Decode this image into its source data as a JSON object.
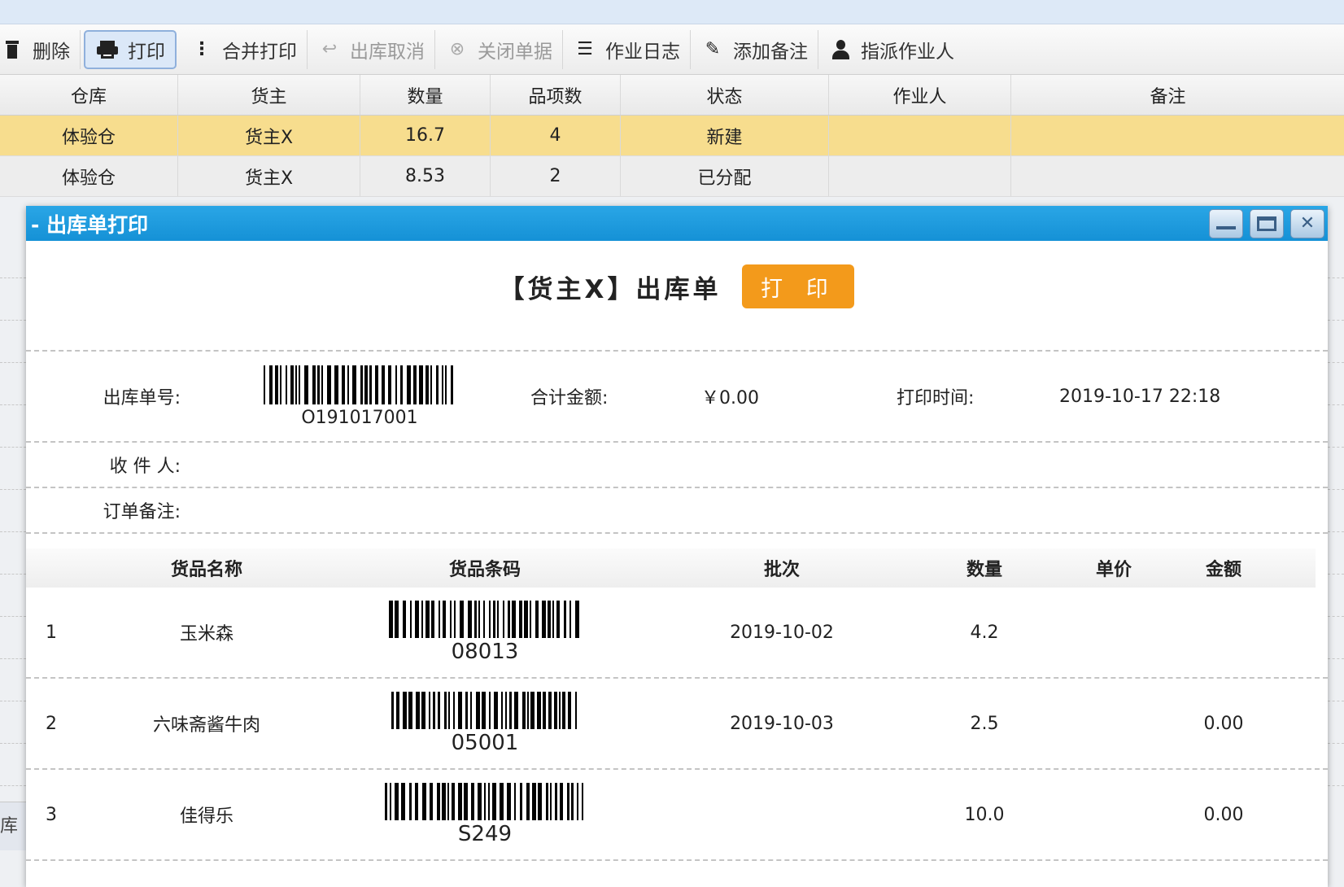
{
  "toolbar": {
    "delete_label": "删除",
    "print_label": "打印",
    "merge_print_label": "合并打印",
    "cancel_outbound_label": "出库取消",
    "close_doc_label": "关闭单据",
    "work_log_label": "作业日志",
    "add_note_label": "添加备注",
    "assign_worker_label": "指派作业人"
  },
  "grid": {
    "columns": [
      "仓库",
      "货主",
      "数量",
      "品项数",
      "状态",
      "作业人",
      "备注"
    ],
    "rows": [
      {
        "warehouse": "体验仓",
        "owner": "货主X",
        "qty": "16.7",
        "items": "4",
        "status": "新建",
        "worker": "",
        "note": ""
      },
      {
        "warehouse": "体验仓",
        "owner": "货主X",
        "qty": "8.53",
        "items": "2",
        "status": "已分配",
        "worker": "",
        "note": ""
      }
    ],
    "partial_bottom_label": "库"
  },
  "dialog": {
    "title": "- 出库单打印",
    "doc_title": "【货主X】出库单",
    "print_button": "打 印",
    "order_no_label": "出库单号:",
    "order_no": "O191017001",
    "total_label": "合计金额:",
    "total_value": "￥0.00",
    "print_time_label": "打印时间:",
    "print_time": "2019-10-17 22:18",
    "recipient_label": "收 件 人:",
    "order_note_label": "订单备注:",
    "items_columns": [
      "",
      "货品名称",
      "货品条码",
      "批次",
      "数量",
      "单价",
      "金额"
    ],
    "items": [
      {
        "index": "1",
        "name": "玉米森",
        "barcode": "08013",
        "batch": "2019-10-02",
        "qty": "4.2",
        "price": "",
        "amount": ""
      },
      {
        "index": "2",
        "name": "六味斋酱牛肉",
        "barcode": "05001",
        "batch": "2019-10-03",
        "qty": "2.5",
        "price": "",
        "amount": "0.00"
      },
      {
        "index": "3",
        "name": "佳得乐",
        "barcode": "S249",
        "batch": "",
        "qty": "10.0",
        "price": "",
        "amount": "0.00"
      }
    ]
  },
  "colors": {
    "titlebar": "#1591d6",
    "print_button": "#f39a1b",
    "selected_row": "#f7dd8e"
  },
  "icons": [
    "trash-icon",
    "printer-icon",
    "vertical-dots-icon",
    "undo-arrow-icon",
    "circle-x-icon",
    "list-icon",
    "pencil-icon",
    "person-icon",
    "minimize-icon",
    "maximize-icon",
    "close-icon"
  ]
}
